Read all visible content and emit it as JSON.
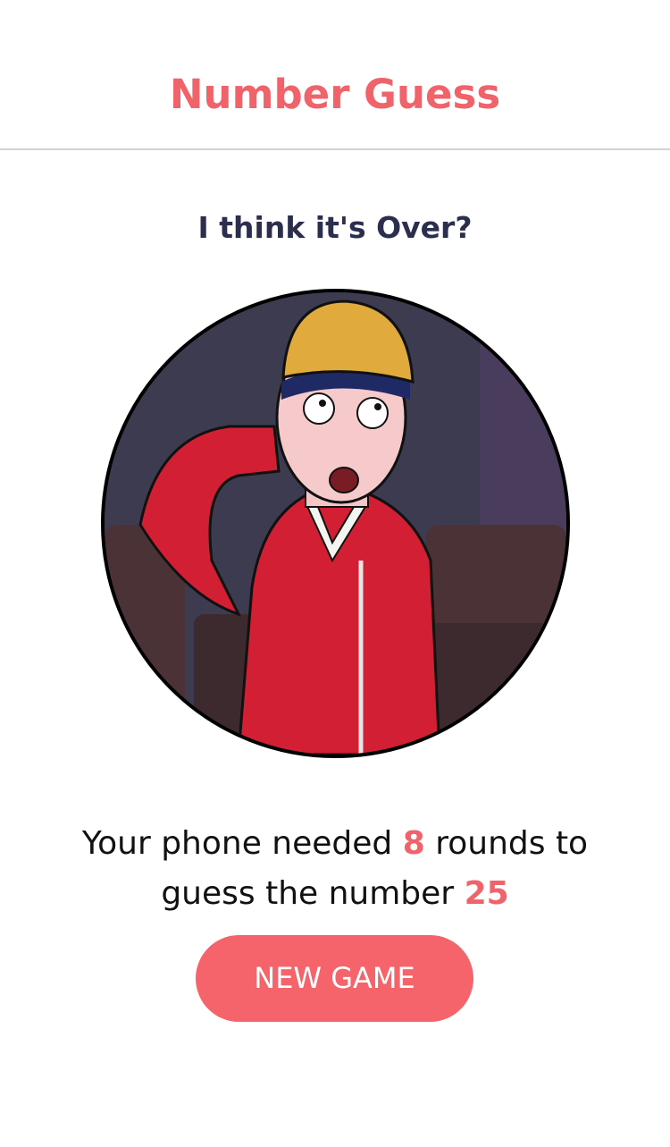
{
  "app": {
    "title": "Number Guess",
    "accent_color": "#f0636a",
    "heading_color": "#2b2f4d"
  },
  "result": {
    "heading": "I think it's Over?",
    "image_icon": "cartoon-character-portrait",
    "summary": {
      "prefix": "Your phone needed ",
      "rounds": "8",
      "middle": " rounds to guess the number ",
      "number": "25"
    }
  },
  "actions": {
    "new_game_label": "NEW GAME"
  }
}
